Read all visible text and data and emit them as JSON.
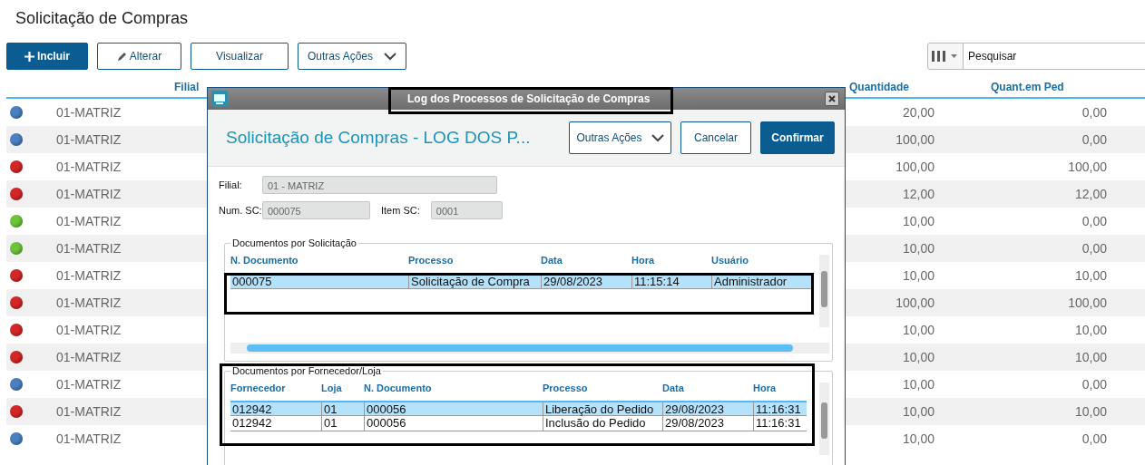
{
  "page_title": "Solicitação de Compras",
  "toolbar": {
    "buttons": [
      {
        "label": "Incluir",
        "kind": "primary"
      },
      {
        "label": "Alterar",
        "kind": "edit"
      },
      {
        "label": "Visualizar",
        "kind": "plain"
      },
      {
        "label": "Outras Ações",
        "kind": "dropdown"
      }
    ],
    "search": {
      "placeholder": "Pesquisar"
    }
  },
  "table": {
    "columns": [
      "Filial",
      "Quantidade",
      "Quant.em Ped"
    ],
    "rows": [
      {
        "color": "#4a7fc0",
        "filial": "01-MATRIZ",
        "quantidade": "20,00",
        "quant_em_ped": "0,00"
      },
      {
        "color": "#4a7fc0",
        "filial": "01-MATRIZ",
        "quantidade": "100,00",
        "quant_em_ped": "0,00"
      },
      {
        "color": "#d42626",
        "filial": "01-MATRIZ",
        "quantidade": "100,00",
        "quant_em_ped": "100,00"
      },
      {
        "color": "#d42626",
        "filial": "01-MATRIZ",
        "quantidade": "12,00",
        "quant_em_ped": "12,00"
      },
      {
        "color": "#6cc43a",
        "filial": "01-MATRIZ",
        "quantidade": "10,00",
        "quant_em_ped": "0,00"
      },
      {
        "color": "#6cc43a",
        "filial": "01-MATRIZ",
        "quantidade": "10,00",
        "quant_em_ped": "0,00"
      },
      {
        "color": "#d42626",
        "filial": "01-MATRIZ",
        "quantidade": "10,00",
        "quant_em_ped": "10,00"
      },
      {
        "color": "#d42626",
        "filial": "01-MATRIZ",
        "quantidade": "100,00",
        "quant_em_ped": "100,00"
      },
      {
        "color": "#d42626",
        "filial": "01-MATRIZ",
        "quantidade": "10,00",
        "quant_em_ped": "10,00"
      },
      {
        "color": "#d42626",
        "filial": "01-MATRIZ",
        "quantidade": "10,00",
        "quant_em_ped": "10,00"
      },
      {
        "color": "#4a7fc0",
        "filial": "01-MATRIZ",
        "quantidade": "10,00",
        "quant_em_ped": "0,00"
      },
      {
        "color": "#d42626",
        "filial": "01-MATRIZ",
        "quantidade": "10,00",
        "quant_em_ped": "10,00"
      },
      {
        "color": "#4a7fc0",
        "filial": "01-MATRIZ",
        "quantidade": "10,00",
        "quant_em_ped": "0,00"
      }
    ]
  },
  "dialog": {
    "title": "Log dos Processos de Solicitação de Compras",
    "heading": "Solicitação de Compras - LOG DOS P...",
    "buttons": [
      {
        "label": "Outras Ações",
        "kind": "dropdown"
      },
      {
        "label": "Cancelar",
        "kind": "plain"
      },
      {
        "label": "Confirmar",
        "kind": "primary"
      }
    ],
    "fields": {
      "filial": {
        "label": "Filial:",
        "value": "01 - MATRIZ"
      },
      "num_sc": {
        "label": "Num. SC:",
        "value": "000075"
      },
      "item_sc": {
        "label": "Item SC:",
        "value": "0001"
      }
    },
    "docs_solicitacao": {
      "legend": "Documentos por Solicitação",
      "columns": [
        "N. Documento",
        "Processo",
        "Data",
        "Hora",
        "Usuário"
      ],
      "rows": [
        {
          "selected": true,
          "cells": [
            "000075",
            "Solicitação de Compra",
            "29/08/2023",
            "11:15:14",
            "Administrador"
          ]
        }
      ]
    },
    "docs_fornecedor": {
      "legend": "Documentos por Fornecedor/Loja",
      "columns": [
        "Fornecedor",
        "Loja",
        "N. Documento",
        "Processo",
        "Data",
        "Hora"
      ],
      "rows": [
        {
          "selected": true,
          "cells": [
            "012942",
            "01",
            "000056",
            "Liberação do Pedido",
            "29/08/2023",
            "11:16:31"
          ]
        },
        {
          "selected": false,
          "cells": [
            "012942",
            "01",
            "000056",
            "Inclusão do Pedido",
            "29/08/2023",
            "11:16:31"
          ]
        }
      ]
    }
  }
}
